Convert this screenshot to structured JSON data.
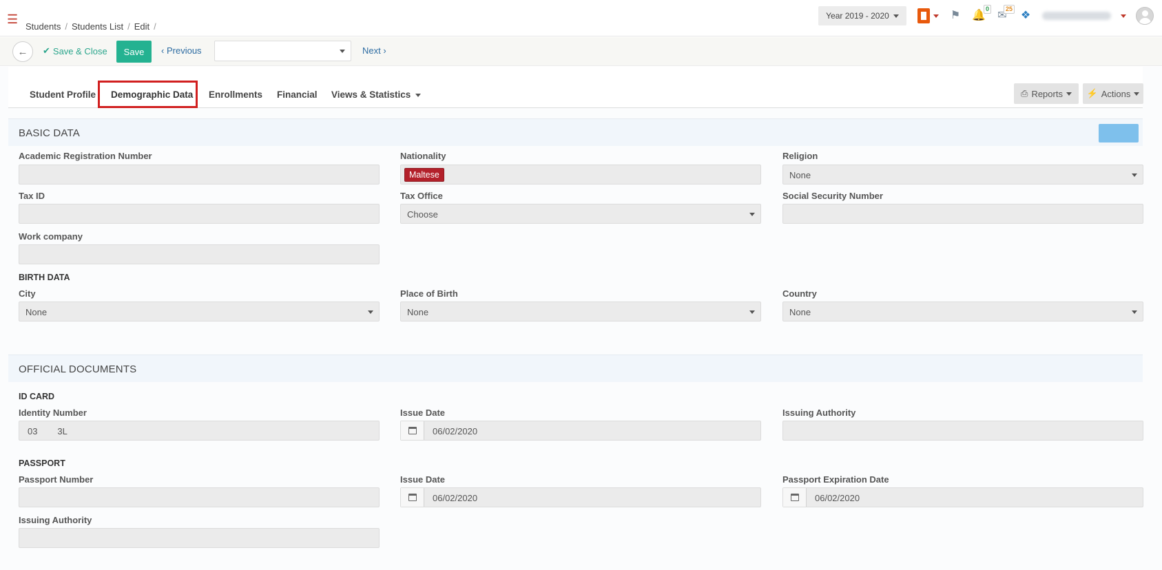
{
  "header": {
    "breadcrumb": [
      "Students",
      "Students List",
      "Edit"
    ],
    "year": "Year 2019 - 2020",
    "notifications_count": "0",
    "messages_count": "25"
  },
  "toolbar": {
    "save_close_label": "Save & Close",
    "save_label": "Save",
    "previous_label": "Previous",
    "next_label": "Next",
    "record_select_value": ""
  },
  "tabs": [
    {
      "label": "Student Profile"
    },
    {
      "label": "Demographic Data",
      "active": true
    },
    {
      "label": "Enrollments"
    },
    {
      "label": "Financial"
    },
    {
      "label": "Views & Statistics"
    }
  ],
  "actions": {
    "reports_label": "Reports",
    "actions_label": "Actions"
  },
  "basic_data": {
    "title": "BASIC DATA",
    "academic_reg_label": "Academic Registration Number",
    "academic_reg_value": "",
    "nationality_label": "Nationality",
    "nationality_value": "Maltese",
    "religion_label": "Religion",
    "religion_value": "None",
    "tax_id_label": "Tax ID",
    "tax_id_value": "",
    "tax_office_label": "Tax Office",
    "tax_office_value": "Choose",
    "ssn_label": "Social Security Number",
    "ssn_value": "",
    "work_company_label": "Work company",
    "work_company_value": "",
    "birth_data_title": "BIRTH DATA",
    "city_label": "City",
    "city_value": "None",
    "place_of_birth_label": "Place of Birth",
    "place_of_birth_value": "None",
    "country_label": "Country",
    "country_value": "None"
  },
  "official_documents": {
    "title": "OFFICIAL DOCUMENTS",
    "id_card_title": "ID CARD",
    "identity_number_label": "Identity Number",
    "identity_number_value": "03        3L",
    "id_issue_date_label": "Issue Date",
    "id_issue_date_value": "06/02/2020",
    "id_issuing_authority_label": "Issuing Authority",
    "id_issuing_authority_value": "",
    "passport_title": "PASSPORT",
    "passport_number_label": "Passport Number",
    "passport_number_value": "",
    "passport_issue_date_label": "Issue Date",
    "passport_issue_date_value": "06/02/2020",
    "passport_expiration_label": "Passport Expiration Date",
    "passport_expiration_value": "06/02/2020",
    "passport_issuing_authority_label": "Issuing Authority",
    "passport_issuing_authority_value": ""
  }
}
